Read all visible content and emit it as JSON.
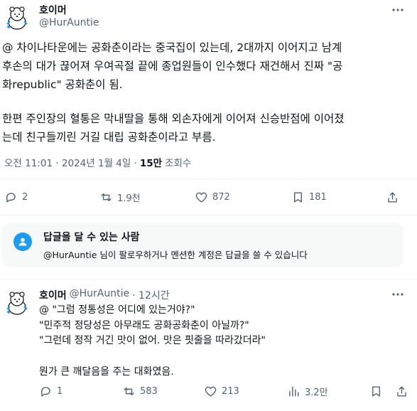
{
  "tweet": {
    "author_name": "호이머",
    "author_handle": "@HurAuntie",
    "paragraph1": "@ 차이나타운에는 공화춘이라는 중국집이 있는데, 2대까지 이어지고 남계\n후손의 대가 끊어져 우여곡절 끝에 종업원들이 인수했다 재건해서 진짜 \"공\n화republic\" 공화춘이 됨.",
    "paragraph2": "한편 주인장의 혈통은 막내딸을 통해 외손자에게 이어져 신승반점에 이어졌\n는데 친구들끼린 거길 대립 공화춘이라고 부름.",
    "timestamp": "오전 11:01 · 2024년 1월 4일 ·",
    "views_count": "15만",
    "views_label": "조회수",
    "replies": "2",
    "reposts": "1.9천",
    "likes": "872",
    "bookmarks": "181"
  },
  "reply_notice": {
    "title": "답글을 달 수 있는 사람",
    "body": "@HurAuntie 님이 팔로우하거나 멘션한 계정은 답글을 쓸 수 있습니다"
  },
  "reply": {
    "author_name": "호이머",
    "author_handle": "@HurAuntie",
    "time": "· 12시간",
    "lines": [
      "@ \"그럼 정통성은 어디에 있는거야?\"",
      "\"민주적 정당성은 아무래도 공화공화춘이 아닐까?\"",
      "\"그런데 정작 거긴 맛이 없어. 맛은 핏줄을 따라갔더라\"",
      "",
      "뭔가 큰 깨달음을 주는 대화였음."
    ],
    "replies": "1",
    "reposts": "583",
    "likes": "213",
    "views": "3.2만"
  },
  "colors": {
    "accent": "#1d9bf0",
    "text": "#0f1419",
    "secondary": "#536471",
    "divider": "#eff3f4",
    "notice_bg": "#f7f9f9"
  },
  "icons": [
    "avatar-bear-icon",
    "more-icon",
    "reply-icon",
    "repost-icon",
    "like-icon",
    "bookmark-icon",
    "share-icon",
    "views-icon",
    "people-icon"
  ]
}
